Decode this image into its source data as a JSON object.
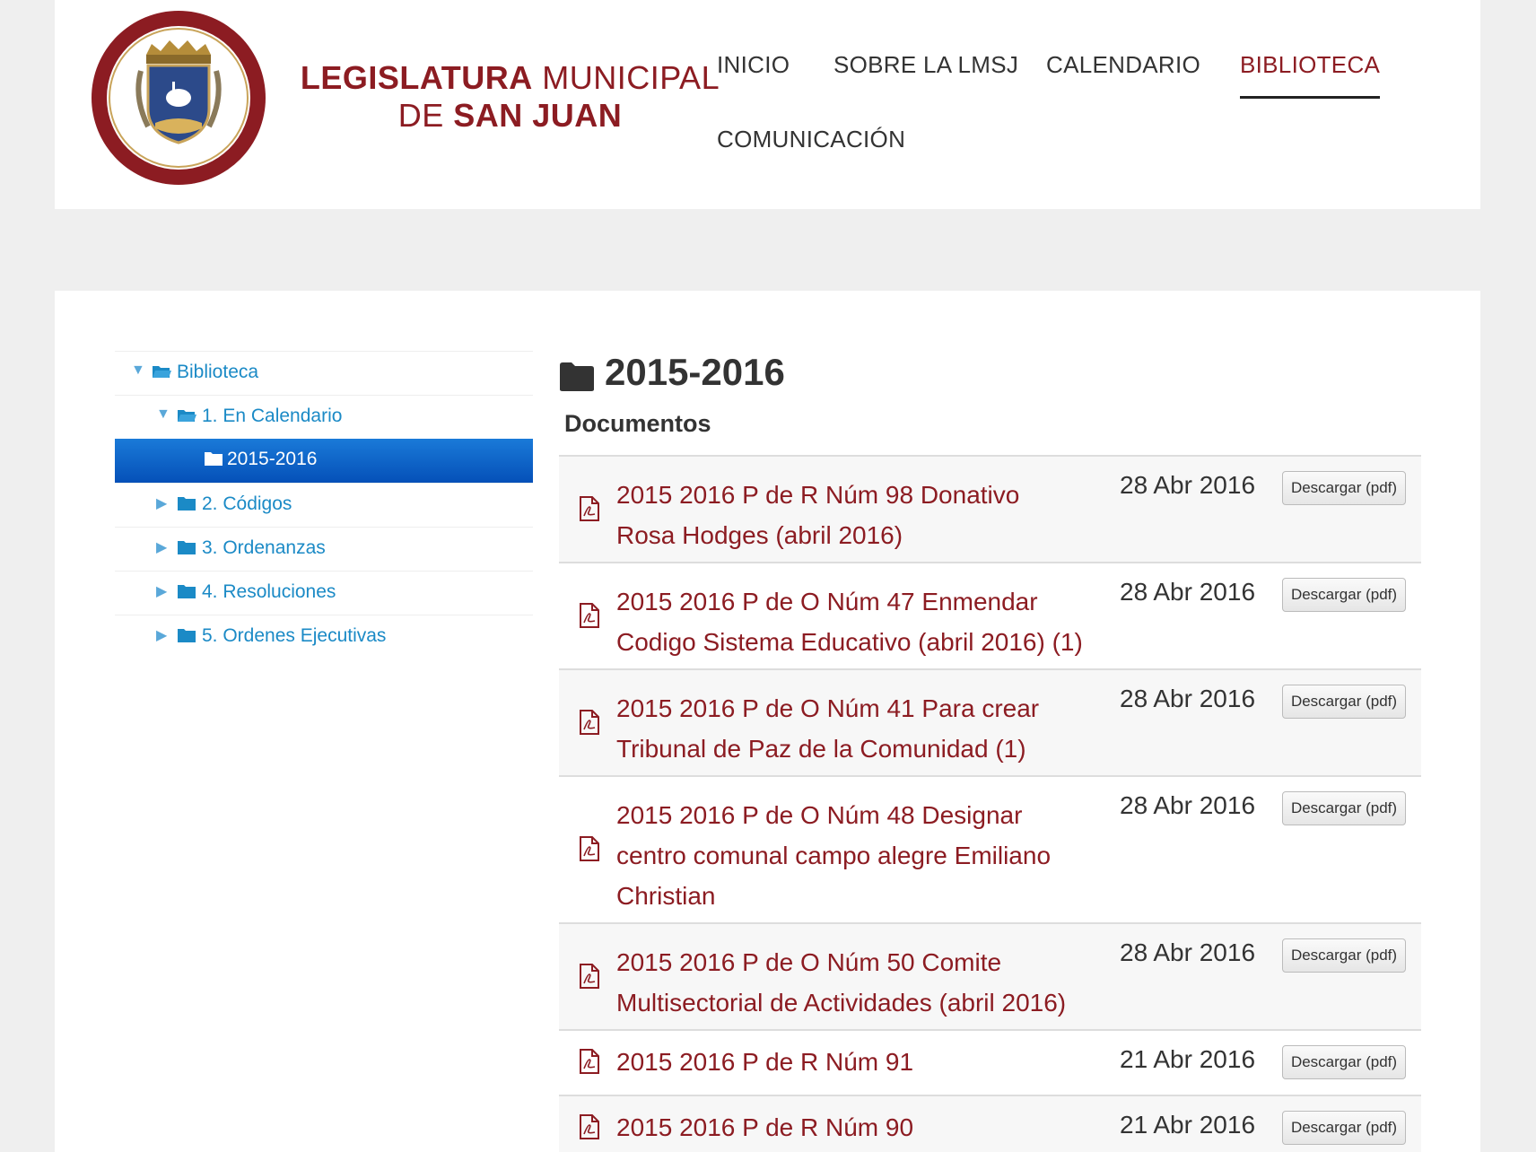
{
  "brand": {
    "line1_bold": "LEGISLATURA",
    "line1_light": "MUNICIPAL",
    "line2_light": "DE",
    "line2_bold": "SAN JUAN",
    "seal_text": "LEGISLATURA MUNICIPAL DE SAN JUAN"
  },
  "nav": {
    "items": [
      {
        "label": "INICIO"
      },
      {
        "label": "SOBRE LA LMSJ"
      },
      {
        "label": "CALENDARIO"
      },
      {
        "label": "BIBLIOTECA",
        "active": true
      },
      {
        "label": "COMUNICACIÓN"
      }
    ]
  },
  "sidebar": {
    "tree": [
      {
        "label": "Biblioteca",
        "expanded": true
      },
      {
        "label": "1. En Calendario",
        "expanded": true
      },
      {
        "label": "2015-2016",
        "selected": true
      },
      {
        "label": "2. Códigos",
        "expanded": false
      },
      {
        "label": "3. Ordenanzas",
        "expanded": false
      },
      {
        "label": "4. Resoluciones",
        "expanded": false
      },
      {
        "label": "5. Ordenes Ejecutivas",
        "expanded": false
      }
    ]
  },
  "main": {
    "title": "2015-2016",
    "section": "Documentos",
    "download_label": "Descargar",
    "download_suffix": "(pdf)",
    "documents": [
      {
        "title": "2015 2016 P de R Núm 98 Donativo Rosa Hodges (abril 2016)",
        "date": "28 Abr 2016"
      },
      {
        "title": "2015 2016 P de O Núm 47 Enmendar Codigo Sistema Educativo (abril 2016) (1)",
        "date": "28 Abr 2016"
      },
      {
        "title": "2015 2016 P de O Núm 41 Para crear Tribunal de Paz de la Comunidad (1)",
        "date": "28 Abr 2016"
      },
      {
        "title": "2015 2016 P de O Núm 48 Designar centro comunal campo alegre Emiliano Christian",
        "date": "28 Abr 2016"
      },
      {
        "title": "2015 2016 P de O Núm 50 Comite Multisectorial de Actividades (abril 2016)",
        "date": "28 Abr 2016"
      },
      {
        "title": "2015 2016 P de R Núm 91",
        "date": "21 Abr 2016"
      },
      {
        "title": "2015 2016 P de R Núm 90",
        "date": "21 Abr 2016"
      }
    ]
  },
  "colors": {
    "brand": "#8c1c22",
    "link": "#1b8ac6",
    "selected_bg": "#0d64c9",
    "page_bg": "#efefef"
  }
}
